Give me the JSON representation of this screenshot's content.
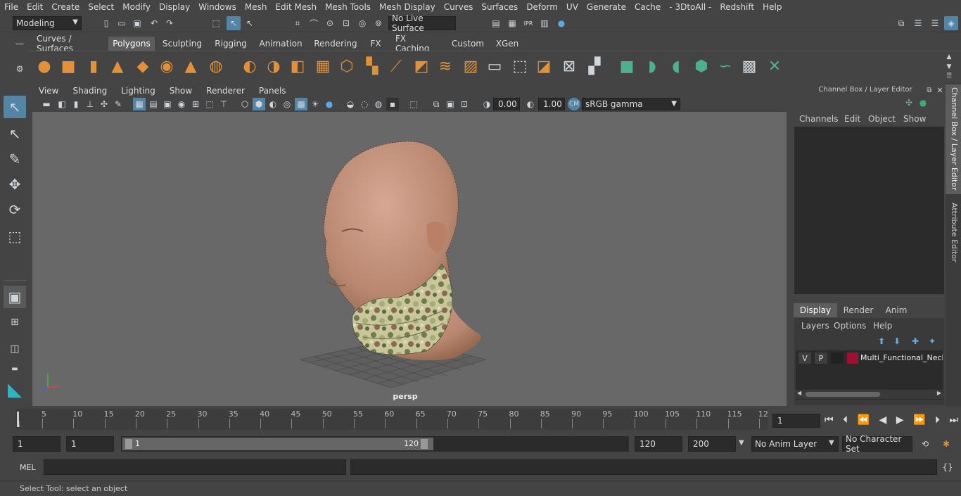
{
  "menubar": [
    "File",
    "Edit",
    "Create",
    "Select",
    "Modify",
    "Display",
    "Windows",
    "Mesh",
    "Edit Mesh",
    "Mesh Tools",
    "Mesh Display",
    "Curves",
    "Surfaces",
    "Deform",
    "UV",
    "Generate",
    "Cache",
    "- 3DtoAll -",
    "Redshift",
    "Help"
  ],
  "status": {
    "mode": "Modeling",
    "live_surface": "No Live Surface"
  },
  "shelf_tabs": [
    "Curves / Surfaces",
    "Polygons",
    "Sculpting",
    "Rigging",
    "Animation",
    "Rendering",
    "FX",
    "FX Caching",
    "Custom",
    "XGen"
  ],
  "active_shelf_tab": "Polygons",
  "viewport": {
    "menu": [
      "View",
      "Shading",
      "Lighting",
      "Show",
      "Renderer",
      "Panels"
    ],
    "exposure": "0.00",
    "gamma": "1.00",
    "color_space": "sRGB gamma",
    "camera_label": "persp"
  },
  "channel_box": {
    "title": "Channel Box / Layer Editor",
    "menu": [
      "Channels",
      "Edit",
      "Object",
      "Show"
    ],
    "layer_tabs": [
      "Display",
      "Render",
      "Anim"
    ],
    "active_layer_tab": "Display",
    "layer_menu": [
      "Layers",
      "Options",
      "Help"
    ],
    "layer": {
      "v": "V",
      "p": "P",
      "name": "Multi_Functional_Neck",
      "color": "#a01030"
    }
  },
  "side_tabs": [
    "Channel Box / Layer Editor",
    "Attribute Editor"
  ],
  "timeline": {
    "ticks": [
      "5",
      "10",
      "15",
      "20",
      "25",
      "30",
      "35",
      "40",
      "45",
      "50",
      "55",
      "60",
      "65",
      "70",
      "75",
      "80",
      "85",
      "90",
      "95",
      "100",
      "105",
      "110",
      "115",
      "12"
    ],
    "start_mark": "1",
    "current_frame": "1"
  },
  "range": {
    "start": "1",
    "playback_start": "1",
    "slider_start": "1",
    "slider_end": "120",
    "playback_end": "120",
    "end": "200",
    "anim_layer": "No Anim Layer",
    "character_set": "No Character Set"
  },
  "mel": {
    "label": "MEL"
  },
  "help_text": "Select Tool: select an object",
  "colors": {
    "accent": "#5285a6",
    "shelf_orange": "#e0913a",
    "shelf_green": "#4fb08e",
    "skin": "#c89884"
  }
}
